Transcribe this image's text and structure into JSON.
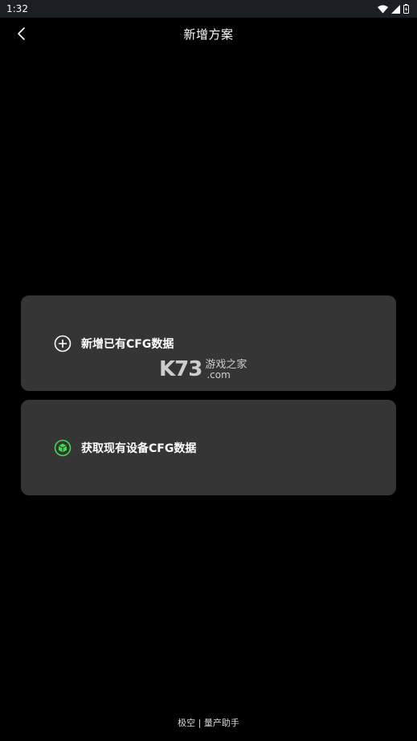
{
  "status_bar": {
    "time": "1:32",
    "icons": [
      "wifi-icon",
      "signal-icon",
      "battery-icon"
    ]
  },
  "header": {
    "title": "新增方案",
    "back_icon": "chevron-left-icon"
  },
  "options": [
    {
      "label": "新增已有CFG数据",
      "icon": "plus-circle-icon",
      "icon_color": "#ffffff"
    },
    {
      "label": "获取现有设备CFG数据",
      "icon": "cube-icon",
      "icon_color": "#3ddc4b"
    }
  ],
  "watermark": {
    "logo": "K73",
    "text": "游戏之家",
    "domain": ".com"
  },
  "footer": {
    "text": "极空 | 量产助手"
  },
  "colors": {
    "background": "#000000",
    "status_bar": "#1b1f24",
    "card": "#353535",
    "accent_green": "#3ddc4b"
  }
}
